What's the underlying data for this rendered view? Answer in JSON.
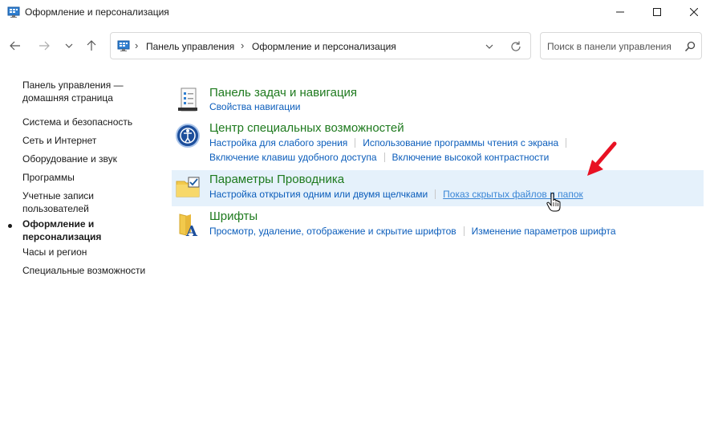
{
  "window": {
    "title": "Оформление и персонализация",
    "icon": "control-panel-icon"
  },
  "navigation": {
    "breadcrumb": [
      "Панель управления",
      "Оформление и персонализация"
    ],
    "search_placeholder": "Поиск в панели управления"
  },
  "sidebar": {
    "items": [
      {
        "label": "Панель управления — домашняя страница"
      },
      {
        "label": "Система и безопасность"
      },
      {
        "label": "Сеть и Интернет"
      },
      {
        "label": "Оборудование и звук"
      },
      {
        "label": "Программы"
      },
      {
        "label": "Учетные записи пользователей"
      },
      {
        "label": "Оформление и персонализация",
        "active": true
      },
      {
        "label": "Часы и регион"
      },
      {
        "label": "Специальные возможности"
      }
    ]
  },
  "categories": [
    {
      "title": "Панель задач и навигация",
      "icon": "taskbar-icon",
      "links": [
        "Свойства навигации"
      ]
    },
    {
      "title": "Центр специальных возможностей",
      "icon": "accessibility-icon",
      "links": [
        "Настройка для слабого зрения",
        "Использование программы чтения с экрана",
        "Включение клавиш удобного доступа",
        "Включение высокой контрастности"
      ]
    },
    {
      "title": "Параметры Проводника",
      "icon": "folder-options-icon",
      "highlighted": true,
      "links": [
        "Настройка открытия одним или двумя щелчками",
        "Показ скрытых файлов и папок"
      ]
    },
    {
      "title": "Шрифты",
      "icon": "fonts-icon",
      "links": [
        "Просмотр, удаление, отображение и скрытие шрифтов",
        "Изменение параметров шрифта"
      ]
    }
  ],
  "colors": {
    "category_title": "#1e7a1e",
    "link": "#0b5dbb",
    "highlight_bg": "#e5f1fb",
    "annotation_arrow": "#e81123"
  }
}
